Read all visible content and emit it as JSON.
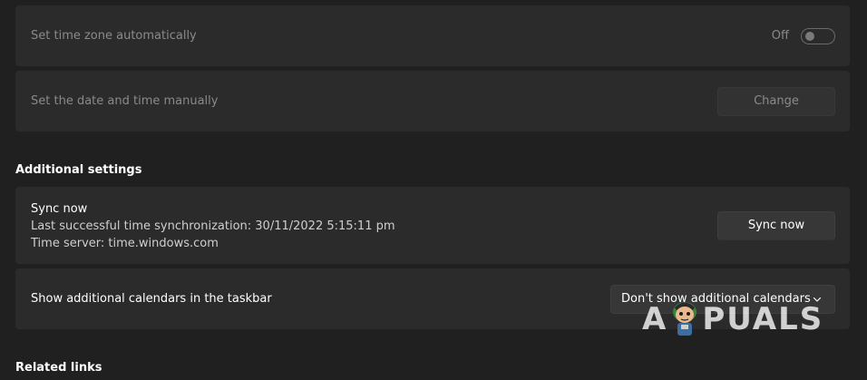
{
  "time_zone": {
    "label": "Set time zone automatically",
    "toggle_state": "Off"
  },
  "manual_time": {
    "label": "Set the date and time manually",
    "button_label": "Change"
  },
  "additional_settings": {
    "heading": "Additional settings",
    "sync": {
      "title": "Sync now",
      "last_sync": "Last successful time synchronization: 30/11/2022 5:15:11 pm",
      "time_server": "Time server: time.windows.com",
      "button_label": "Sync now"
    },
    "calendars": {
      "label": "Show additional calendars in the taskbar",
      "selected": "Don't show additional calendars"
    }
  },
  "related_links": {
    "heading": "Related links"
  },
  "watermark": {
    "letter_a": "A",
    "rest": "PUALS"
  },
  "icons": {
    "dropdown": "chevron-down-icon",
    "watermark_mascot": "appuals-mascot-icon"
  },
  "colors": {
    "background": "#202020",
    "card": "#2b2b2b",
    "button": "#373737",
    "disabled_text": "#8a8a8a"
  }
}
